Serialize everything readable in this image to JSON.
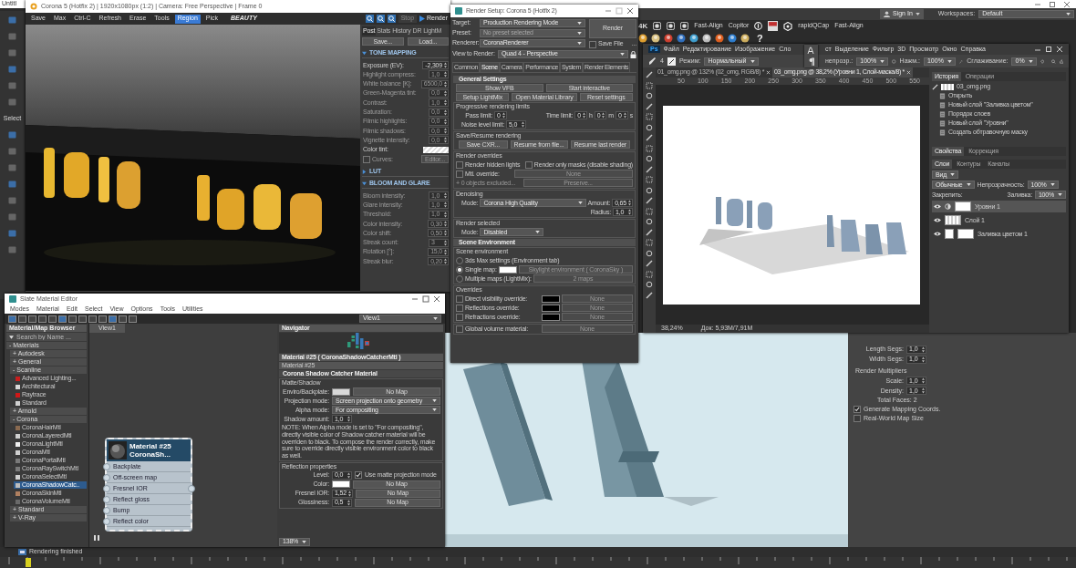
{
  "max": {
    "title": "Untitl",
    "select_label": "Select",
    "sign_in": "Sign In",
    "workspaces_label": "Workspaces:",
    "workspace": "Default",
    "plugin_labels": [
      "4K",
      "Fast-Align",
      "Copitor",
      "rapidQCap",
      "Fast-Align"
    ],
    "help": "?",
    "command_panel": [
      {
        "kind": "spinner",
        "label": "Length Segs:",
        "value": "1,0"
      },
      {
        "kind": "spinner",
        "label": "Width Segs:",
        "value": "1,0"
      },
      {
        "kind": "heading",
        "label": "Render Multipliers"
      },
      {
        "kind": "spinner",
        "label": "Scale:",
        "value": "1,0"
      },
      {
        "kind": "spinner",
        "label": "Density:",
        "value": "1,0"
      },
      {
        "kind": "text",
        "label": "Total Faces: 2"
      },
      {
        "kind": "checkbox",
        "label": "Generate Mapping Coords.",
        "checked": true
      },
      {
        "kind": "checkbox",
        "label": "Real-World Map Size",
        "checked": false
      }
    ],
    "status": "Rendering finished"
  },
  "vfb": {
    "title": "Corona 5 (Hotfix 2) | 1920x1080px (1:2) | Camera: Free Perspective | Frame 0",
    "toolbar": [
      {
        "label": "Save",
        "selected": false
      },
      {
        "label": "Max",
        "selected": false
      },
      {
        "label": "Ctrl-C",
        "selected": false
      },
      {
        "label": "Refresh",
        "selected": false
      },
      {
        "label": "Erase",
        "selected": false
      },
      {
        "label": "Tools",
        "selected": false
      },
      {
        "label": "Region",
        "selected": true
      },
      {
        "label": "Pick",
        "selected": false
      }
    ],
    "pass": "BEAUTY",
    "stop": "Stop",
    "render": "Render",
    "tabs": [
      {
        "label": "Post",
        "selected": true
      },
      {
        "label": "Stats",
        "selected": false
      },
      {
        "label": "History",
        "selected": false
      },
      {
        "label": "DR",
        "selected": false
      },
      {
        "label": "LightM",
        "selected": false
      }
    ],
    "file_buttons": [
      "Save...",
      "Load..."
    ],
    "sections": [
      {
        "title": "TONE MAPPING",
        "expanded": true,
        "params": [
          {
            "kind": "spinner",
            "label": "Exposure (EV):",
            "value": "-2,309",
            "enabled": true
          },
          {
            "kind": "spinner",
            "label": "Highlight compress:",
            "value": "1,0",
            "enabled": false
          },
          {
            "kind": "spinner",
            "label": "White balance [K]:",
            "value": "6500,0",
            "enabled": false
          },
          {
            "kind": "spinner",
            "label": "Green-Magenta tint:",
            "value": "0,0",
            "enabled": false
          },
          {
            "kind": "spinner",
            "label": "Contrast:",
            "value": "1,0",
            "enabled": false
          },
          {
            "kind": "spinner",
            "label": "Saturation:",
            "value": "0,0",
            "enabled": false
          },
          {
            "kind": "spinner",
            "label": "Filmic highlights:",
            "value": "0,0",
            "enabled": false
          },
          {
            "kind": "spinner",
            "label": "Filmic shadows:",
            "value": "0,0",
            "enabled": false
          },
          {
            "kind": "spinner",
            "label": "Vignette intensity:",
            "value": "0,0",
            "enabled": false
          },
          {
            "kind": "swatch",
            "label": "Color tint:",
            "enabled": true
          },
          {
            "kind": "curves",
            "label": "Curves:",
            "value": "Editor...",
            "checked": false,
            "enabled": false
          }
        ]
      },
      {
        "title": "LUT",
        "expanded": false
      },
      {
        "title": "BLOOM AND GLARE",
        "expanded": true,
        "params": [
          {
            "kind": "spinner",
            "label": "Bloom intensity:",
            "value": "1,0",
            "enabled": false
          },
          {
            "kind": "spinner",
            "label": "Glare intensity:",
            "value": "1,0",
            "enabled": false
          },
          {
            "kind": "spinner",
            "label": "Threshold:",
            "value": "1,0",
            "enabled": false
          },
          {
            "kind": "spinner",
            "label": "Color intensity:",
            "value": "0,30",
            "enabled": false
          },
          {
            "kind": "spinner",
            "label": "Color shift:",
            "value": "0,50",
            "enabled": false
          },
          {
            "kind": "spinner",
            "label": "Streak count:",
            "value": "3",
            "enabled": false
          },
          {
            "kind": "spinner",
            "label": "Rotation [°]:",
            "value": "15,0",
            "enabled": false
          },
          {
            "kind": "spinner",
            "label": "Streak blur:",
            "value": "0,20",
            "enabled": false
          }
        ]
      }
    ]
  },
  "render_setup": {
    "title": "Render Setup: Corona 5 (Hotfix 2)",
    "target_label": "Target:",
    "target": "Production Rendering Mode",
    "preset_label": "Preset:",
    "preset": "No preset selected",
    "renderer_label": "Renderer:",
    "renderer": "CoronaRenderer",
    "save_file": {
      "label": "Save File",
      "checked": false
    },
    "more": "...",
    "view_label": "View to Render:",
    "view": "Quad 4 - Perspective",
    "render_button": "Render",
    "tabs": [
      {
        "label": "Common",
        "selected": false
      },
      {
        "label": "Scene",
        "selected": true
      },
      {
        "label": "Camera",
        "selected": false
      },
      {
        "label": "Performance",
        "selected": false
      },
      {
        "label": "System",
        "selected": false
      },
      {
        "label": "Render Elements",
        "selected": false
      }
    ],
    "general_title": "General Settings",
    "vfb_buttons": [
      "Show VFB",
      "Start interactive"
    ],
    "lib_buttons": [
      "Setup LightMix",
      "Open Material Library",
      "Reset settings"
    ],
    "limits": {
      "title": "Progressive rendering limits",
      "pass_label": "Pass limit:",
      "pass": "0",
      "time_label": "Time limit:",
      "time": [
        {
          "value": "0",
          "unit": "h"
        },
        {
          "value": "0",
          "unit": "m"
        },
        {
          "value": "0",
          "unit": "s"
        }
      ],
      "noise_label": "Noise level limit:",
      "noise": "5,0"
    },
    "save_resume": {
      "title": "Save/Resume rendering",
      "buttons": [
        "Save CXR...",
        "Resume from file...",
        "Resume last render"
      ]
    },
    "overrides": {
      "title": "Render overrides",
      "hidden_lights": {
        "label": "Render hidden lights",
        "checked": false
      },
      "masks": {
        "label": "Render only masks (disable shading)",
        "checked": false
      },
      "mtl": {
        "label": "Mtl. override:",
        "checked": false,
        "value": "None"
      },
      "excluded": "+ 0 objects excluded...",
      "preserve": "Preserve..."
    },
    "denoising": {
      "title": "Denoising",
      "mode_label": "Mode:",
      "mode": "Corona High Quality",
      "amount_label": "Amount:",
      "amount": "0,65",
      "radius_label": "Radius:",
      "radius": "1,0"
    },
    "render_selected": {
      "title": "Render selected",
      "mode_label": "Mode:",
      "mode": "Disabled"
    },
    "scene_env_title": "Scene Environment",
    "env_label": "Scene environment",
    "env_options": [
      {
        "label": "3ds Max settings (Environment tab)",
        "selected": false
      },
      {
        "label": "Single map:",
        "selected": true,
        "color": "#ffffff",
        "map": "Skylight environment ( CoronaSky )"
      },
      {
        "label": "Multiple maps (LightMix):",
        "selected": false,
        "map": "2 maps"
      }
    ],
    "env_overrides_title": "Overrides",
    "env_overrides": [
      {
        "label": "Direct visibility override:",
        "checked": false,
        "color": "#000000",
        "map": "None"
      },
      {
        "label": "Reflections override:",
        "checked": false,
        "color": "#000000",
        "map": "None"
      },
      {
        "label": "Refractions override:",
        "checked": false,
        "color": "#000000",
        "map": "None"
      }
    ],
    "volume": {
      "label": "Global volume material:",
      "checked": false,
      "value": "None"
    }
  },
  "slate": {
    "title": "Slate Material Editor",
    "menu": [
      "Modes",
      "Material",
      "Edit",
      "Select",
      "View",
      "Options",
      "Tools",
      "Utilities"
    ],
    "browser_title": "Material/Map Browser",
    "search_placeholder": "Search by Name ...",
    "tree": [
      {
        "kind": "group",
        "label": "- Materials",
        "children": [
          {
            "kind": "group",
            "label": "+ Autodesk"
          },
          {
            "kind": "group",
            "label": "+ General"
          },
          {
            "kind": "group",
            "label": "- Scanline",
            "children": [
              {
                "kind": "material",
                "label": "Advanced Lighting...",
                "color": "#c81e1e",
                "selected": false
              },
              {
                "kind": "material",
                "label": "Architectural",
                "color": "#d8d8d8",
                "selected": false
              },
              {
                "kind": "material",
                "label": "Raytrace",
                "color": "#d01818",
                "selected": false
              },
              {
                "kind": "material",
                "label": "Standard",
                "color": "#d0d0d0",
                "selected": false
              }
            ]
          },
          {
            "kind": "group",
            "label": "+ Arnold"
          },
          {
            "kind": "group",
            "label": "- Corona",
            "children": [
              {
                "kind": "material",
                "label": "CoronaHairMtl",
                "color": "#8a6a50",
                "selected": false
              },
              {
                "kind": "material",
                "label": "CoronaLayeredMtl",
                "color": "#cfcfcf",
                "selected": false
              },
              {
                "kind": "material",
                "label": "CoronaLightMtl",
                "color": "#eeeeee",
                "selected": false
              },
              {
                "kind": "material",
                "label": "CoronaMtl",
                "color": "#cfcfcf",
                "selected": false
              },
              {
                "kind": "material",
                "label": "CoronaPortalMtl",
                "color": "#7a7a7a",
                "selected": false
              },
              {
                "kind": "material",
                "label": "CoronaRaySwitchMtl",
                "color": "#7a7a7a",
                "selected": false
              },
              {
                "kind": "material",
                "label": "CoronaSelectMtl",
                "color": "#d0d0d0",
                "selected": false
              },
              {
                "kind": "material",
                "label": "CoronaShadowCatc..",
                "color": "#bdbdbd",
                "selected": true
              },
              {
                "kind": "material",
                "label": "CoronaSkinMtl",
                "color": "#b08060",
                "selected": false
              },
              {
                "kind": "material",
                "label": "CoronaVolumeMtl",
                "color": "#6a6a6a",
                "selected": false
              }
            ]
          },
          {
            "kind": "group",
            "label": "+ Standard"
          },
          {
            "kind": "group",
            "label": "+ V-Ray"
          }
        ]
      }
    ],
    "view_tab": "View1",
    "view_dropdown": "View1",
    "node": {
      "title": "Material #25",
      "subtitle": "CoronaSh...",
      "slots": [
        "Backplate",
        "Off-screen map",
        "Fresnel IOR",
        "Reflect gloss",
        "Bump",
        "Reflect color"
      ]
    },
    "navigator_title": "Navigator",
    "params_title": "Material #25  ( CoronaShadowCatcherMtl )",
    "name_field": "Material #25",
    "rollout": "Corona Shadow Catcher Material",
    "matte_group": "Matte/Shadow",
    "backplate_label": "Enviro/Backplate:",
    "backplate_map": "No Map",
    "projection_label": "Projection mode:",
    "projection": "Screen projection onto geometry",
    "alpha_label": "Alpha mode:",
    "alpha": "For compositing",
    "shadow_label": "Shadow amount:",
    "shadow": "1,0",
    "note": "NOTE: When Alpha mode is set to \"For compositing\", directly visible color of Shadow catcher material will be overriden to black. To compose the render correctly, make sure to override directly visible environment color to black as well.",
    "reflection_group": "Reflection properties",
    "level_label": "Level:",
    "level": "0,0",
    "matte_check": {
      "label": "Use matte projection mode",
      "checked": true
    },
    "refl_rows": [
      {
        "kind": "swatch",
        "label": "Color:",
        "map": "No Map"
      },
      {
        "kind": "spinner",
        "label": "Fresnel IOR:",
        "value": "1,52",
        "map": "No Map"
      },
      {
        "kind": "spinner",
        "label": "Glossiness:",
        "value": "0,5",
        "map": "No Map"
      }
    ],
    "zoom": "138%"
  },
  "photoshop": {
    "logo": "Ps",
    "menu": [
      "Файл",
      "Редактирование",
      "Изображение",
      "Сло",
      "ст",
      "Выделение",
      "Фильтр",
      "3D",
      "Просмотр",
      "Окно",
      "Справка"
    ],
    "brush_size": "4",
    "mode_label": "Режим:",
    "mode": "Нормальный",
    "opacity_label": "непрозр.:",
    "opacity": "100%",
    "pressure_label": "Нажм.:",
    "pressure": "100%",
    "smoothing_label": "Сглаживание:",
    "smoothing": "0%",
    "doc_tabs": [
      {
        "label": "01_omg.png @ 132% (02_omg, RGB/8) *",
        "selected": false
      },
      {
        "label": "03_omg.png @ 38,2% (Уровни 1, Слой-маска/8) *",
        "selected": true
      }
    ],
    "ruler": [
      "50",
      "100",
      "150",
      "200",
      "250",
      "300",
      "350",
      "400",
      "450",
      "500",
      "550"
    ],
    "zoom": "38,24%",
    "doc_info": "Док: 5,93M/7,91M",
    "history_tabs": [
      {
        "label": "История",
        "selected": true
      },
      {
        "label": "Операции",
        "selected": false
      }
    ],
    "snapshot": "03_omg.png",
    "history": [
      "Открыть",
      "Новый слой \"Заливка цветом\"",
      "Порядок слоев",
      "Новый слой \"Уровни\"",
      "Создать обтравочную маску"
    ],
    "props_tabs": [
      {
        "label": "Свойства",
        "selected": true
      },
      {
        "label": "Коррекция",
        "selected": false
      }
    ],
    "layer_tabs": [
      {
        "label": "Слои",
        "selected": true
      },
      {
        "label": "Контуры",
        "selected": false
      },
      {
        "label": "Каналы",
        "selected": false
      }
    ],
    "filter": "Вид",
    "blend": "Обычные",
    "layer_opacity_label": "Непрозрачность:",
    "layer_opacity": "100%",
    "lock_label": "Закрепить:",
    "fill_label": "Заливка:",
    "fill": "100%",
    "layers": [
      {
        "kind": "adjustment",
        "name": "Уровни 1",
        "selected": true,
        "visible": true
      },
      {
        "kind": "pixel",
        "name": "Слой 1",
        "selected": false,
        "visible": true
      },
      {
        "kind": "fill",
        "name": "Заливка цветом 1",
        "selected": false,
        "visible": true
      }
    ]
  }
}
